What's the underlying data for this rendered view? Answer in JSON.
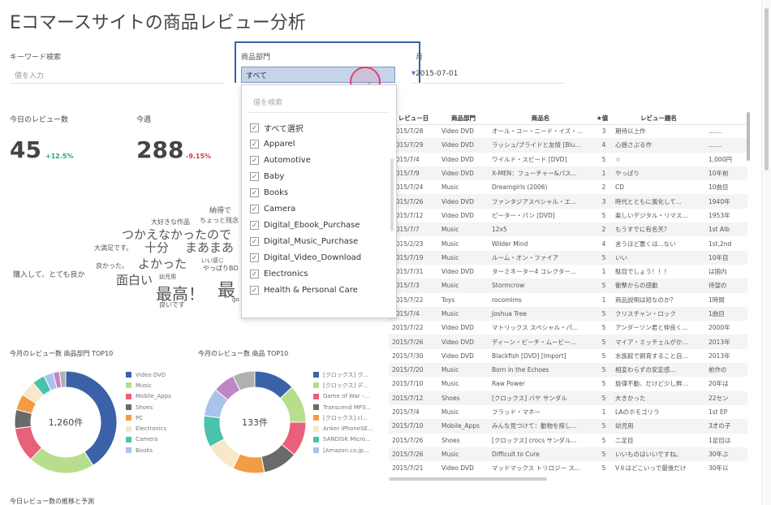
{
  "title": "Eコマースサイトの商品レビュー分析",
  "filters": {
    "keyword_label": "キーワード検索",
    "keyword_placeholder": "値を入力",
    "dept_label": "商品部門",
    "dept_value": "すべて",
    "month_label": "月",
    "month_value": "2015-07-01"
  },
  "dropdown": {
    "search_placeholder": "値を検索",
    "options": [
      "すべて選択",
      "Apparel",
      "Automotive",
      "Baby",
      "Books",
      "Camera",
      "Digital_Ebook_Purchase",
      "Digital_Music_Purchase",
      "Digital_Video_Download",
      "Electronics",
      "Health & Personal Care"
    ]
  },
  "stats": {
    "today_label": "今日のレビュー数",
    "today_value": "45",
    "today_delta": "+12.5%",
    "week_label": "今週",
    "week_value": "288",
    "week_delta": "-9.15%"
  },
  "wordcloud": [
    "納得で",
    "大好きな作品",
    "ちょっと残念",
    "つかえなかったので",
    "大満足です。",
    "十分",
    "まあまあ",
    "良かった。",
    "よかった",
    "いい感じ",
    "やっぱりBD",
    "購入して、とても良か",
    "面白い",
    "幼児用",
    "最高！",
    "最",
    "良いです",
    "go"
  ],
  "donut1": {
    "title": "今月のレビュー数 商品部門 TOP10",
    "center": "1,260件",
    "legend": [
      "Video DVD",
      "Music",
      "Mobile_Apps",
      "Shoes",
      "PC",
      "Electronics",
      "Camera",
      "Books"
    ]
  },
  "donut2": {
    "title": "今月のレビュー数 商品 TOP10",
    "center": "133件",
    "legend": [
      "[クロックス] ク...",
      "[クロックス] デ...",
      "Game of War -...",
      "Transcend MP3...",
      "[クロックス] ci...",
      "Anker iPhoneSE...",
      "SANDISK Micro...",
      "[Amazon.co.jp..."
    ]
  },
  "colors": {
    "palette": [
      "#3b62a8",
      "#b7de8c",
      "#e8607a",
      "#6a6a6a",
      "#f39b45",
      "#f6e8c8",
      "#4bc2ab",
      "#a9c3ea",
      "#c084c8",
      "#b0b0b0"
    ],
    "delta_up": "#23a57a",
    "delta_down": "#d2354e",
    "accent": "#3b5fa8"
  },
  "table": {
    "headers": [
      "レビュー日",
      "商品部門",
      "商品名",
      "★値",
      "レビュー題名",
      ""
    ],
    "rows": [
      [
        "2015/7/28",
        "Video DVD",
        "オール・ユー・ニード・イズ・...",
        "3",
        "期待以上作",
        "......."
      ],
      [
        "2015/7/29",
        "Video DVD",
        "ラッシュ/プライドと友情 [Blu...",
        "4",
        "心揺さぶる作",
        "......."
      ],
      [
        "2015/7/4",
        "Video DVD",
        "ワイルド・スピード [DVD]",
        "5",
        "☆",
        "1,000円"
      ],
      [
        "2015/7/9",
        "Video DVD",
        "X-MEN：フューチャー&パス...",
        "1",
        "やっぱり",
        "10年前"
      ],
      [
        "2015/7/24",
        "Music",
        "Dreamgirls (2006)",
        "2",
        "CD",
        "10曲目"
      ],
      [
        "2015/7/26",
        "Video DVD",
        "ファンタジアスペシャル・エ...",
        "3",
        "時代とともに風化して...",
        "1940年"
      ],
      [
        "2015/7/12",
        "Video DVD",
        "ピーター・パン [DVD]",
        "5",
        "楽しいデジタル・リマス...",
        "1953年"
      ],
      [
        "2015/7/7",
        "Music",
        "12x5",
        "2",
        "もうすでに有名天？",
        "1st Alb"
      ],
      [
        "2015/2/23",
        "Music",
        "Wilder Mind",
        "4",
        "言うほど悪くは...ない",
        "1st,2nd"
      ],
      [
        "2015/7/19",
        "Music",
        "ルーム・オン・ファイア",
        "5",
        "いい",
        "10年目"
      ],
      [
        "2015/7/31",
        "Video DVD",
        "ターミネーター4 コレクター...",
        "1",
        "駄目でしょう！！！",
        "は国内"
      ],
      [
        "2015/7/3",
        "Music",
        "Stormcrow",
        "5",
        "衝撃からの感動",
        "待望の"
      ],
      [
        "2015/7/22",
        "Toys",
        "rocomims",
        "1",
        "商品説明は短なのか？",
        "1時間"
      ],
      [
        "2015/7/4",
        "Music",
        "Joshua Tree",
        "5",
        "クリスチャン・ロック",
        "1曲目"
      ],
      [
        "2015/7/22",
        "Video DVD",
        "マトリックス スペシャル・パ...",
        "5",
        "アンダーソン君と仲良く...",
        "2000年"
      ],
      [
        "2015/7/26",
        "Video DVD",
        "ディーン・ビーチ・ムービー...",
        "5",
        "マイア・ミッチェルがか...",
        "2013年"
      ],
      [
        "2015/7/30",
        "Video DVD",
        "Blackfish [DVD] [Import]",
        "5",
        "水族館で飼育すること自...",
        "2013年"
      ],
      [
        "2015/7/20",
        "Music",
        "Born in the Echoes",
        "5",
        "相変わらずの安定感...",
        "前作の"
      ],
      [
        "2015/7/10",
        "Music",
        "Raw Power",
        "5",
        "旋律不動、だけど少し鮮...",
        "20年は"
      ],
      [
        "2015/7/12",
        "Shoes",
        "[クロックス] バヤ サンダル",
        "5",
        "大きかった",
        "22セン"
      ],
      [
        "2015/7/4",
        "Music",
        "フラッド・マネー",
        "1",
        "LAのホモゴリラ",
        "1st EP"
      ],
      [
        "2015/7/10",
        "Mobile_Apps",
        "みんな見つけて：動物を探し...",
        "5",
        "幼児用",
        "3才の子"
      ],
      [
        "2015/7/26",
        "Shoes",
        "[クロックス] crocs サンダル...",
        "5",
        "二足目",
        "1足目は"
      ],
      [
        "2015/7/26",
        "Music",
        "Difficult to Cure",
        "5",
        "いいものはいいですね。",
        "30年ぶ"
      ],
      [
        "2015/7/21",
        "Video DVD",
        "マッドマックス トリロジー ス...",
        "5",
        "V８はどこいっで最後だけ",
        "30年以"
      ]
    ]
  },
  "bottom_title": "今日レビュー数の推移と予測"
}
